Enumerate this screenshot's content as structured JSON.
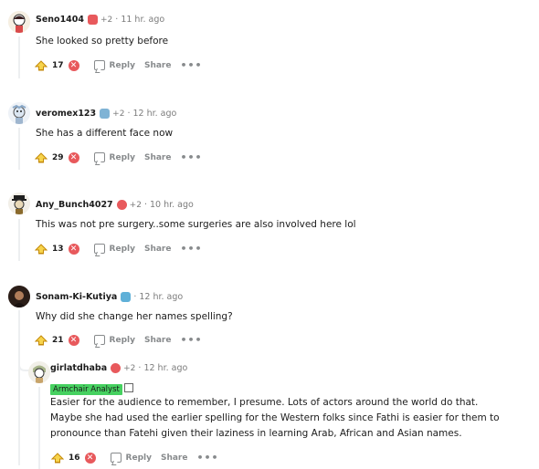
{
  "comments": [
    {
      "author": "Seno1404",
      "plus": "+2",
      "time": "11 hr. ago",
      "text": "She looked so pretty before",
      "score": "17",
      "reply_label": "Reply",
      "share_label": "Share",
      "more_label": "•••",
      "flair_color": "#e8595c"
    },
    {
      "author": "veromex123",
      "plus": "+2",
      "time": "12 hr. ago",
      "text": "She has a different face now",
      "score": "29",
      "reply_label": "Reply",
      "share_label": "Share",
      "more_label": "•••",
      "flair_color": "#7fb3d5"
    },
    {
      "author": "Any_Bunch4027",
      "plus": "+2",
      "time": "10 hr. ago",
      "text": "This was not pre surgery..some surgeries are also involved here lol",
      "score": "13",
      "reply_label": "Reply",
      "share_label": "Share",
      "more_label": "•••",
      "flair_color": "#e8595c"
    },
    {
      "author": "Sonam-Ki-Kutiya",
      "plus": "",
      "time": "12 hr. ago",
      "text": "Why did she change her names spelling?",
      "score": "21",
      "reply_label": "Reply",
      "share_label": "Share",
      "more_label": "•••",
      "flair_color": "#5fb0d8"
    },
    {
      "author": "girlatdhaba",
      "plus": "+2",
      "time": "12 hr. ago",
      "badge": "Armchair Analyst",
      "text_lines": [
        "Easier for the audience to remember, I presume. Lots of actors around the world do that.",
        "Maybe she had used the earlier spelling for the Western folks since Fathi is easier for them to",
        "pronounce than Fatehi given their laziness in learning Arab, African and Asian names."
      ],
      "score": "16",
      "reply_label": "Reply",
      "share_label": "Share",
      "more_label": "•••",
      "flair_color": "#e8595c"
    }
  ],
  "separator": "·",
  "downvote_symbol": "✕",
  "colors": {
    "accent_upvote": "#d4a017",
    "downvote": "#e8595c",
    "badge_bg": "#46d160",
    "muted": "#7c7c7c"
  }
}
